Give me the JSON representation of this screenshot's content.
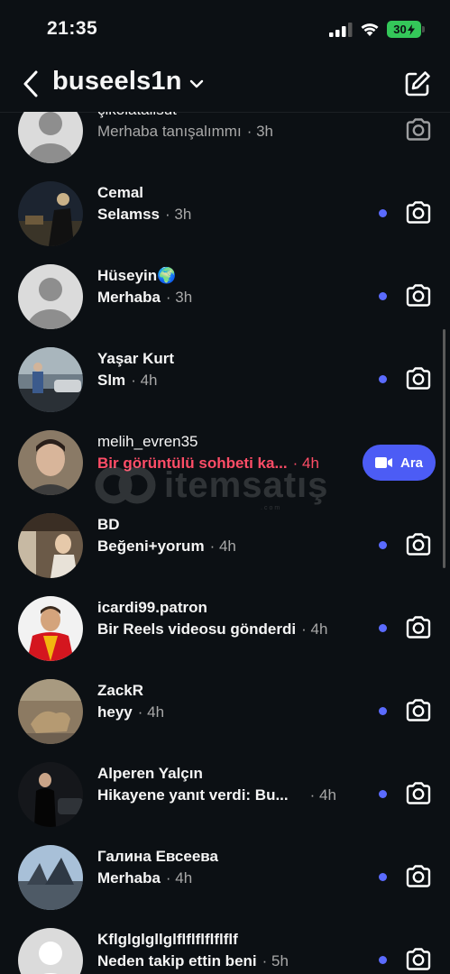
{
  "status_bar": {
    "time": "21:35",
    "battery": "30"
  },
  "header": {
    "title": "buseels1n"
  },
  "conversations": [
    {
      "name": "çikolatalisut",
      "message": "Merhaba tanışalımmı",
      "time": "· 3h",
      "unread": false,
      "action": "camera"
    },
    {
      "name": "Cemal",
      "message": "Selamss",
      "time": "· 3h",
      "unread": true,
      "action": "camera"
    },
    {
      "name": "Hüseyin🌍",
      "message": "Merhaba",
      "time": "· 3h",
      "unread": true,
      "action": "camera"
    },
    {
      "name": "Yaşar Kurt",
      "message": "Slm",
      "time": "· 4h",
      "unread": true,
      "action": "camera"
    },
    {
      "name": "melih_evren35",
      "message": "Bir görüntülü sohbeti ka...",
      "time": "· 4h",
      "unread": false,
      "action": "call"
    },
    {
      "name": "BD",
      "message": "Beğeni+yorum",
      "time": "· 4h",
      "unread": true,
      "action": "camera"
    },
    {
      "name": "icardi99.patron",
      "message": "Bir Reels videosu gönderdi",
      "time": "· 4h",
      "unread": true,
      "action": "camera"
    },
    {
      "name": "ZackR",
      "message": "heyy",
      "time": "· 4h",
      "unread": true,
      "action": "camera"
    },
    {
      "name": "Alperen Yalçın",
      "message": "Hikayene yanıt verdi: Bu...",
      "time": "· 4h",
      "unread": true,
      "action": "camera"
    },
    {
      "name": "Галина Евсеева",
      "message": "Merhaba",
      "time": "· 4h",
      "unread": true,
      "action": "camera"
    },
    {
      "name": "Kflglglgllglflflflflflflf",
      "message": "Neden takip ettin beni",
      "time": "· 5h",
      "unread": true,
      "action": "camera"
    }
  ],
  "call_button": {
    "label": "Ara"
  },
  "watermark": {
    "text": "itemsatış",
    "suffix": ".com"
  },
  "colors": {
    "background": "#0c1014",
    "unread_dot": "#5b6bff",
    "call_button": "#4c5cf5",
    "alert_text": "#ff4d67",
    "battery": "#34c759"
  }
}
